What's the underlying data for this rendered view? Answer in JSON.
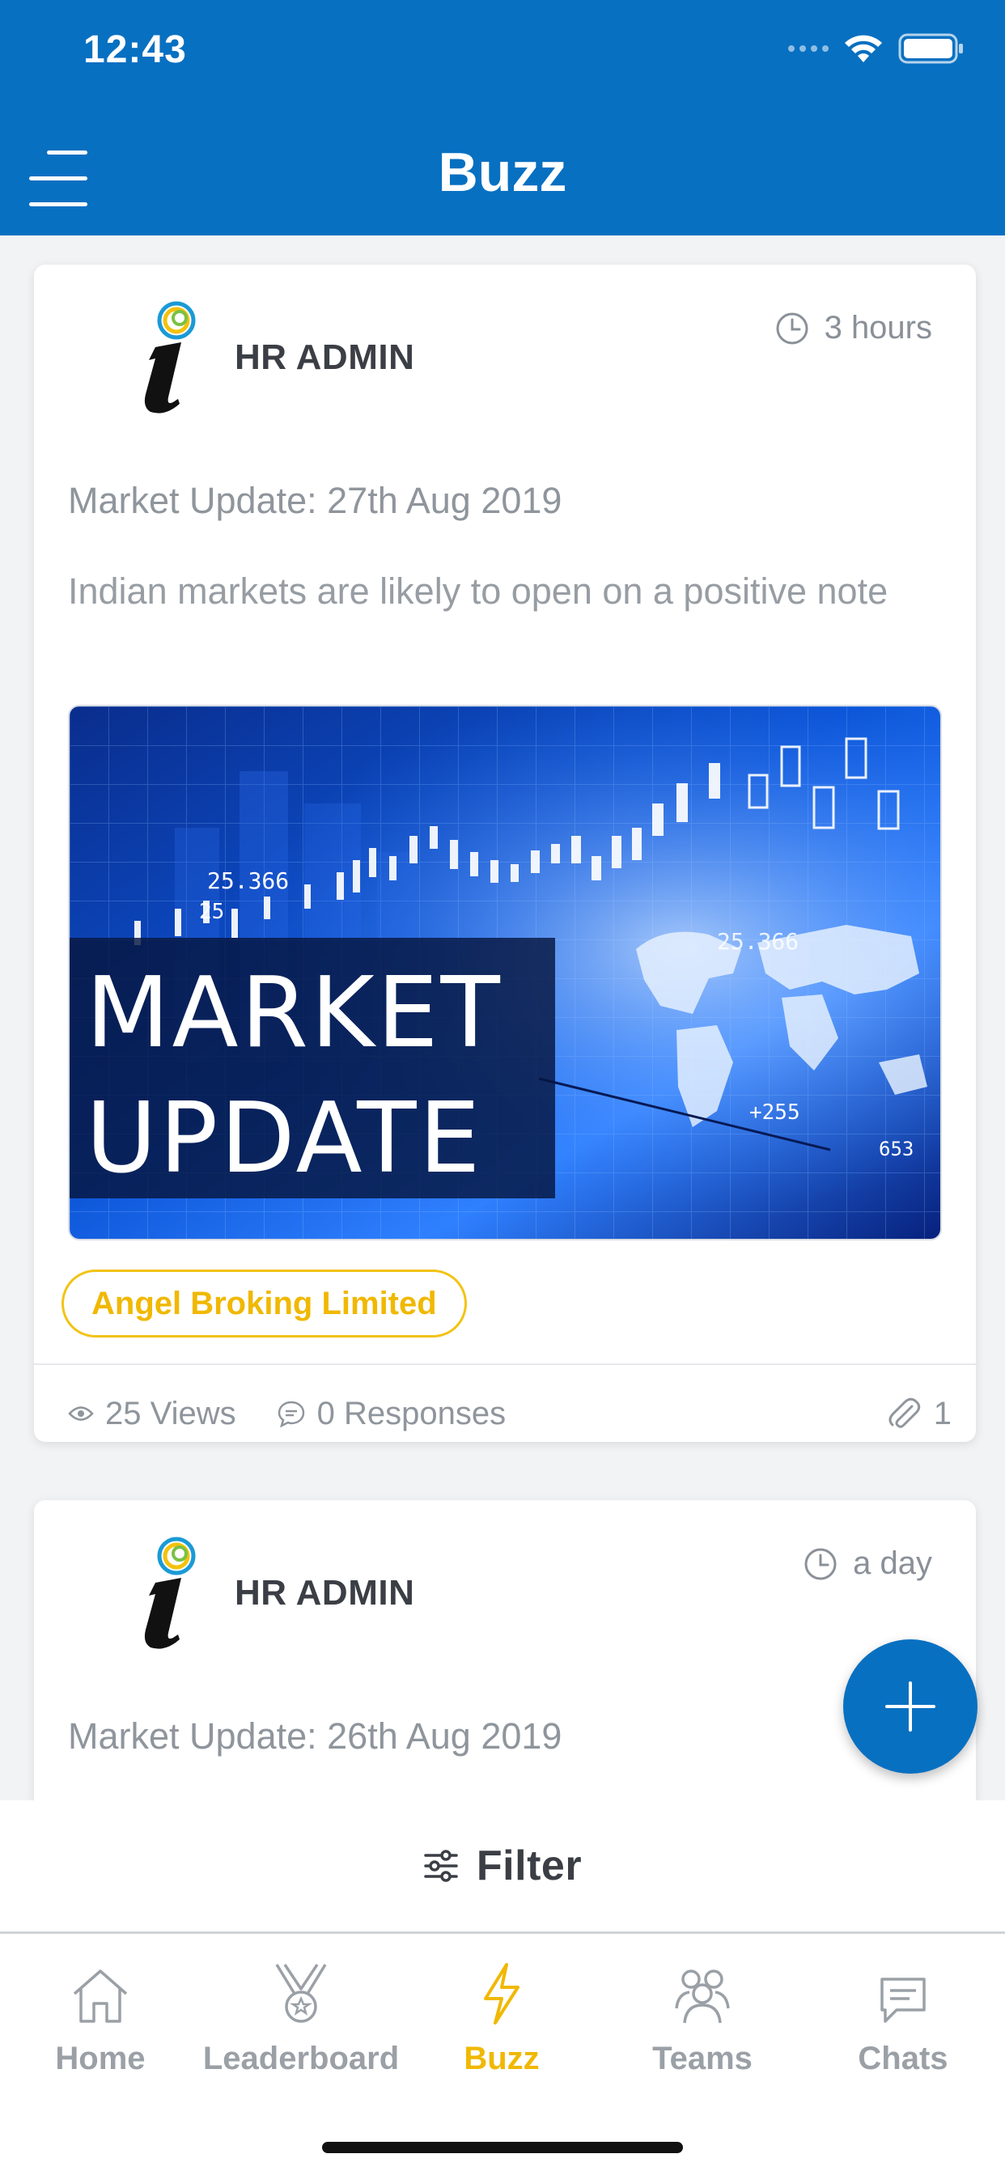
{
  "status_bar": {
    "time": "12:43"
  },
  "header": {
    "title": "Buzz"
  },
  "posts": [
    {
      "author": "HR ADMIN",
      "time": "3 hours",
      "title": "Market Update: 27th Aug 2019",
      "body": "Indian markets are likely to open on a positive note",
      "image": {
        "headline_line1": "MARKET",
        "headline_line2": "UPDATE",
        "label_a": "25.366",
        "label_b": "25",
        "label_c": "25.366",
        "label_d": "+255",
        "label_e": "653"
      },
      "tag": "Angel Broking Limited",
      "views": "25 Views",
      "responses": "0 Responses",
      "attachments": "1"
    },
    {
      "author": "HR ADMIN",
      "time": "a day",
      "title": "Market Update: 26th Aug 2019"
    }
  ],
  "filter": {
    "label": "Filter"
  },
  "tabs": [
    {
      "label": "Home",
      "icon": "home-icon"
    },
    {
      "label": "Leaderboard",
      "icon": "trophy-icon"
    },
    {
      "label": "Buzz",
      "icon": "lightning-icon"
    },
    {
      "label": "Teams",
      "icon": "team-icon"
    },
    {
      "label": "Chats",
      "icon": "chat-icon"
    }
  ],
  "colors": {
    "brand_blue": "#0870c1",
    "active_tab": "#f0b800",
    "tag_border": "#f2c314"
  }
}
